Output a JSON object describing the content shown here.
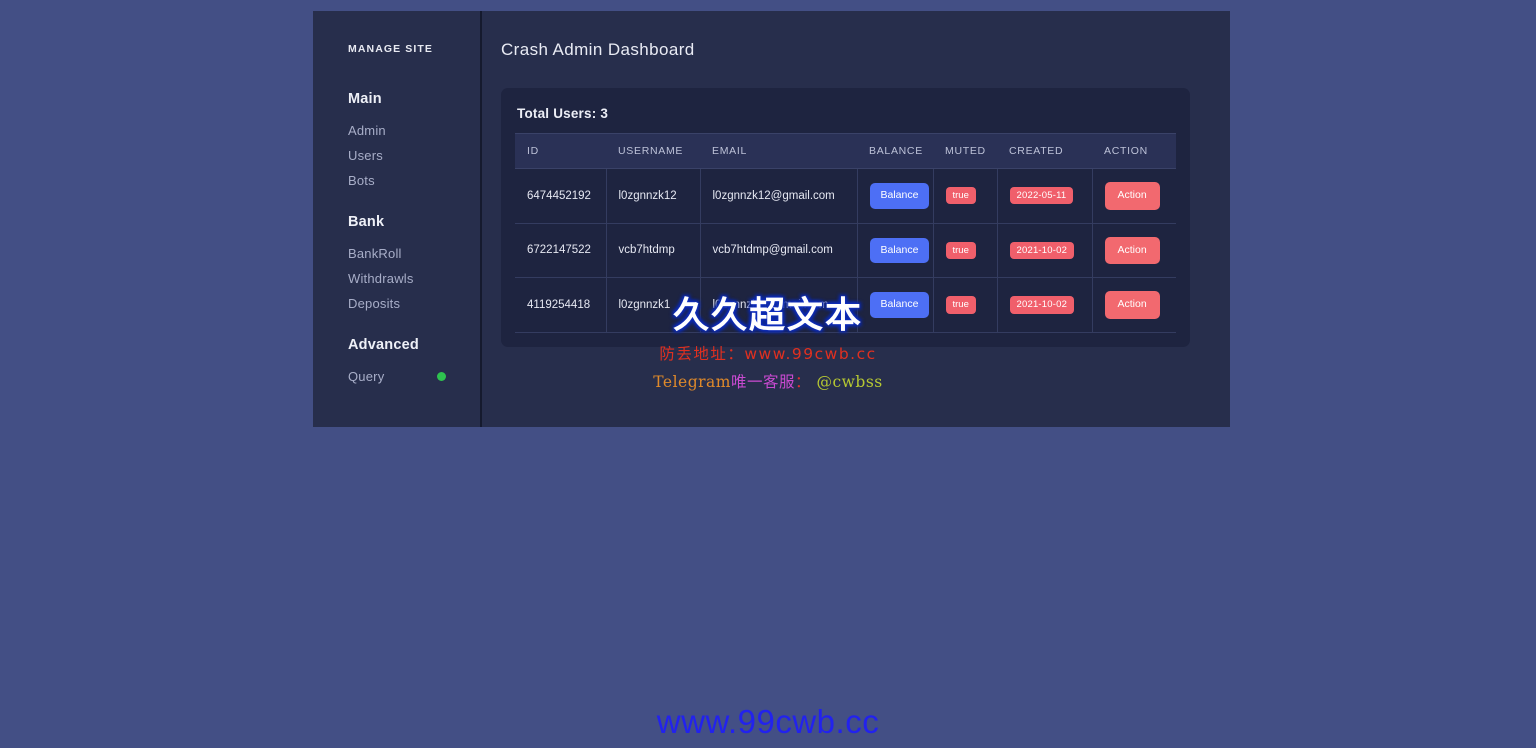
{
  "sidebar": {
    "brand": "MANAGE SITE",
    "groups": [
      {
        "title": "Main",
        "items": [
          {
            "label": "Admin",
            "name": "sidebar-item-admin",
            "dot": false
          },
          {
            "label": "Users",
            "name": "sidebar-item-users",
            "dot": false
          },
          {
            "label": "Bots",
            "name": "sidebar-item-bots",
            "dot": false
          }
        ]
      },
      {
        "title": "Bank",
        "items": [
          {
            "label": "BankRoll",
            "name": "sidebar-item-bankroll",
            "dot": false
          },
          {
            "label": "Withdrawls",
            "name": "sidebar-item-withdrawls",
            "dot": false
          },
          {
            "label": "Deposits",
            "name": "sidebar-item-deposits",
            "dot": false
          }
        ]
      },
      {
        "title": "Advanced",
        "items": [
          {
            "label": "Query",
            "name": "sidebar-item-query",
            "dot": true
          }
        ]
      }
    ]
  },
  "header": {
    "title": "Crash Admin Dashboard"
  },
  "users_card": {
    "total_users_label": "Total Users: 3",
    "total_users_count": 3,
    "columns": [
      "ID",
      "USERNAME",
      "EMAIL",
      "BALANCE",
      "MUTED",
      "CREATED",
      "ACTION"
    ],
    "rows": [
      {
        "id": "6474452192",
        "username": "l0zgnnzk12",
        "email": "l0zgnnzk12@gmail.com",
        "balance_label": "Balance",
        "muted": "true",
        "created": "2022-05-11",
        "action_label": "Action"
      },
      {
        "id": "6722147522",
        "username": "vcb7htdmp",
        "email": "vcb7htdmp@gmail.com",
        "balance_label": "Balance",
        "muted": "true",
        "created": "2021-10-02",
        "action_label": "Action"
      },
      {
        "id": "4119254418",
        "username": "l0zgnnzk1",
        "email": "l0zgnnzk1@gmail.com",
        "balance_label": "Balance",
        "muted": "true",
        "created": "2021-10-02",
        "action_label": "Action"
      }
    ]
  },
  "watermark": {
    "main": "久久超文本",
    "line2": "防丢地址：www.99cwb.cc",
    "line3_prefix": "Telegram",
    "line3_cn": "唯一客服",
    "line3_colon": "：",
    "line3_handle": "@cwbss",
    "bottom": "www.99cwb.cc"
  },
  "colors": {
    "page_background": "#434f85",
    "panel_background": "#272e4c",
    "card_background": "#1e2440",
    "table_header_background": "#2a3156",
    "accent_blue": "#4d6ff5",
    "accent_red": "#f2696f",
    "status_green": "#2ec24f"
  }
}
